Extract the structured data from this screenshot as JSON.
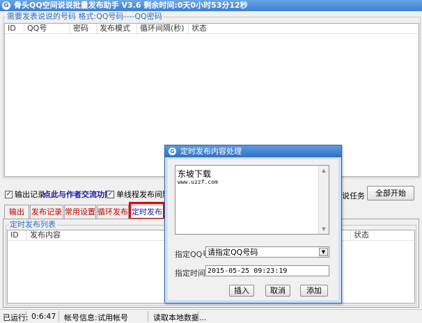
{
  "window": {
    "title": "骨头QQ空间说说批量发布助手 V3.6 剩余时间:0天0小时53分12秒",
    "icon": "G"
  },
  "accounts": {
    "legend": "需要发表说说的号码 格式:QQ号码----QQ密码",
    "columns": [
      "ID",
      "QQ号",
      "密码",
      "发布模式",
      "循环间隔(秒)",
      "状态"
    ]
  },
  "options": {
    "output_log": {
      "label": "输出记录",
      "checked": true
    },
    "author_link": "点此与作者交流功能",
    "single_thread": {
      "label": "单线程发布间隔",
      "checked": true
    },
    "task_label": "说任务",
    "start_all": "全部开始"
  },
  "tabs": [
    {
      "label": "输出"
    },
    {
      "label": "发布记录"
    },
    {
      "label": "常用设置"
    },
    {
      "label": "循环发布"
    },
    {
      "label": "定时发布"
    }
  ],
  "scheduled": {
    "legend": "定时发布列表",
    "columns": [
      "ID",
      "发布内容",
      "状态"
    ]
  },
  "statusbar": {
    "running_label": "已运行:",
    "running_value": "0:6:47",
    "account_label": "帐号信息:",
    "account_value": "试用帐号",
    "message": "读取本地数据..."
  },
  "dialog": {
    "title": "定时发布内容处理",
    "content_title": "东坡下载",
    "content_url": "www.uzzf.com",
    "qq_label": "指定QQ号",
    "qq_value": "请指定QQ号码",
    "time_label": "指定时间",
    "time_value": "2015-05-25 09:23:19",
    "insert": "插入",
    "cancel": "取消",
    "add": "添加"
  },
  "colors": {
    "highlight_box": "#e00000",
    "title_bar": "#3b7fd1",
    "tab_text": "#c00000",
    "link": "#1a1aa8"
  }
}
